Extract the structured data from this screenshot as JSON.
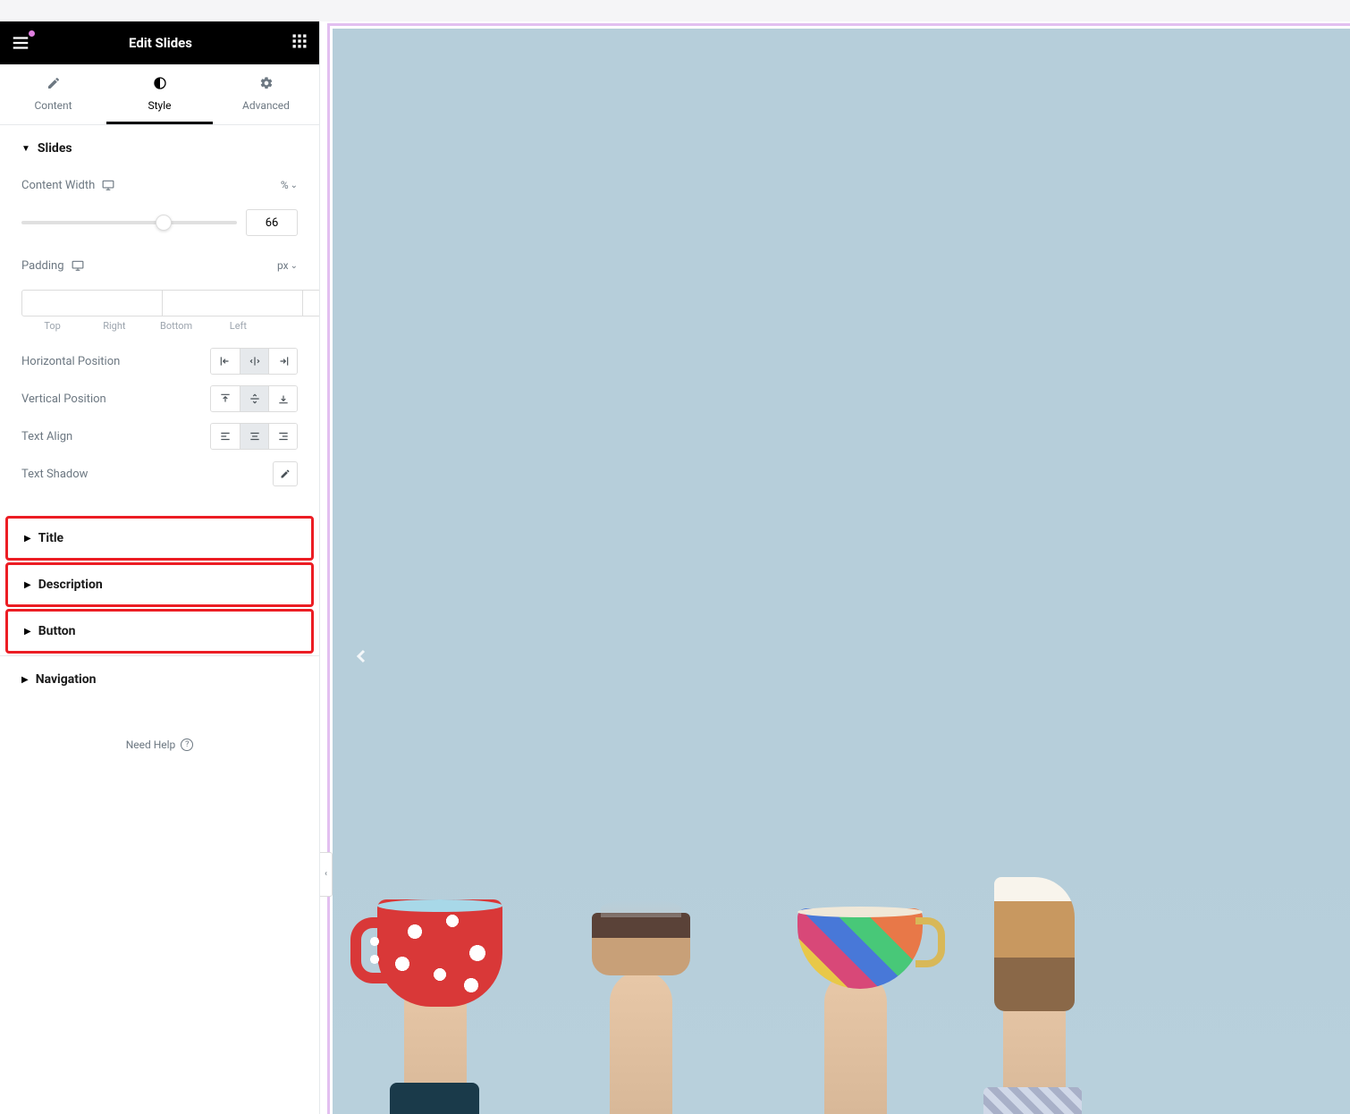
{
  "header": {
    "title": "Edit Slides"
  },
  "tabs": {
    "content": "Content",
    "style": "Style",
    "advanced": "Advanced"
  },
  "sections": {
    "slides": {
      "title": "Slides",
      "contentWidth": {
        "label": "Content Width",
        "unit": "%",
        "value": "66"
      },
      "padding": {
        "label": "Padding",
        "unit": "px",
        "sides": {
          "top": "Top",
          "right": "Right",
          "bottom": "Bottom",
          "left": "Left"
        }
      },
      "hPos": "Horizontal Position",
      "vPos": "Vertical Position",
      "textAlign": "Text Align",
      "textShadow": "Text Shadow"
    },
    "title": "Title",
    "description": "Description",
    "button": "Button",
    "navigation": "Navigation"
  },
  "help": "Need Help"
}
